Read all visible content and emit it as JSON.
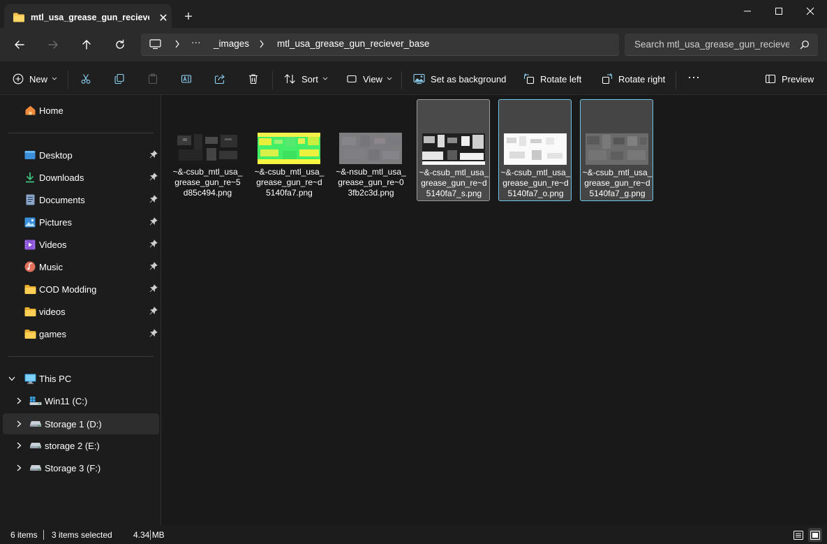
{
  "window": {
    "tab_title": "mtl_usa_grease_gun_reciever_",
    "new_tab_glyph": "+",
    "close_tab_glyph": "✕"
  },
  "nav": {
    "back_icon": "arrow-left-icon",
    "forward_icon": "arrow-right-icon",
    "up_icon": "arrow-up-icon",
    "refresh_icon": "refresh-icon"
  },
  "address": {
    "more_glyph": "···",
    "crumbs": [
      "_images",
      "mtl_usa_grease_gun_reciever_base"
    ]
  },
  "search": {
    "placeholder": "Search mtl_usa_grease_gun_recieve"
  },
  "toolbar": {
    "new_label": "New",
    "sort_label": "Sort",
    "view_label": "View",
    "set_background_label": "Set as background",
    "rotate_left_label": "Rotate left",
    "rotate_right_label": "Rotate right",
    "more_glyph": "···",
    "preview_label": "Preview"
  },
  "sidebar": {
    "home": "Home",
    "quick_access": [
      "Desktop",
      "Downloads",
      "Documents",
      "Pictures",
      "Videos",
      "Music",
      "COD Modding",
      "videos",
      "games"
    ],
    "this_pc": "This PC",
    "drives": [
      "Win11 (C:)",
      "Storage 1 (D:)",
      "storage 2 (E:)",
      "Storage 3 (F:)"
    ]
  },
  "files": [
    {
      "name": "~&-csub_mtl_usa_grease_gun_re~5d85c494.png",
      "selected": false
    },
    {
      "name": "~&-csub_mtl_usa_grease_gun_re~d5140fa7.png",
      "selected": false
    },
    {
      "name": "~&-nsub_mtl_usa_grease_gun_re~03fb2c3d.png",
      "selected": false
    },
    {
      "name": "~&-csub_mtl_usa_grease_gun_re~d5140fa7_s.png",
      "selected": true
    },
    {
      "name": "~&-csub_mtl_usa_grease_gun_re~d5140fa7_o.png",
      "selected": true
    },
    {
      "name": "~&-csub_mtl_usa_grease_gun_re~d5140fa7_g.png",
      "selected": true
    }
  ],
  "status": {
    "item_count": "6 items",
    "selected_info": "3 items selected",
    "size": "4.34 MB"
  },
  "colors": {
    "accent": "#74c6e8",
    "folder": "#f4c04e",
    "background": "#1c1c1c"
  }
}
